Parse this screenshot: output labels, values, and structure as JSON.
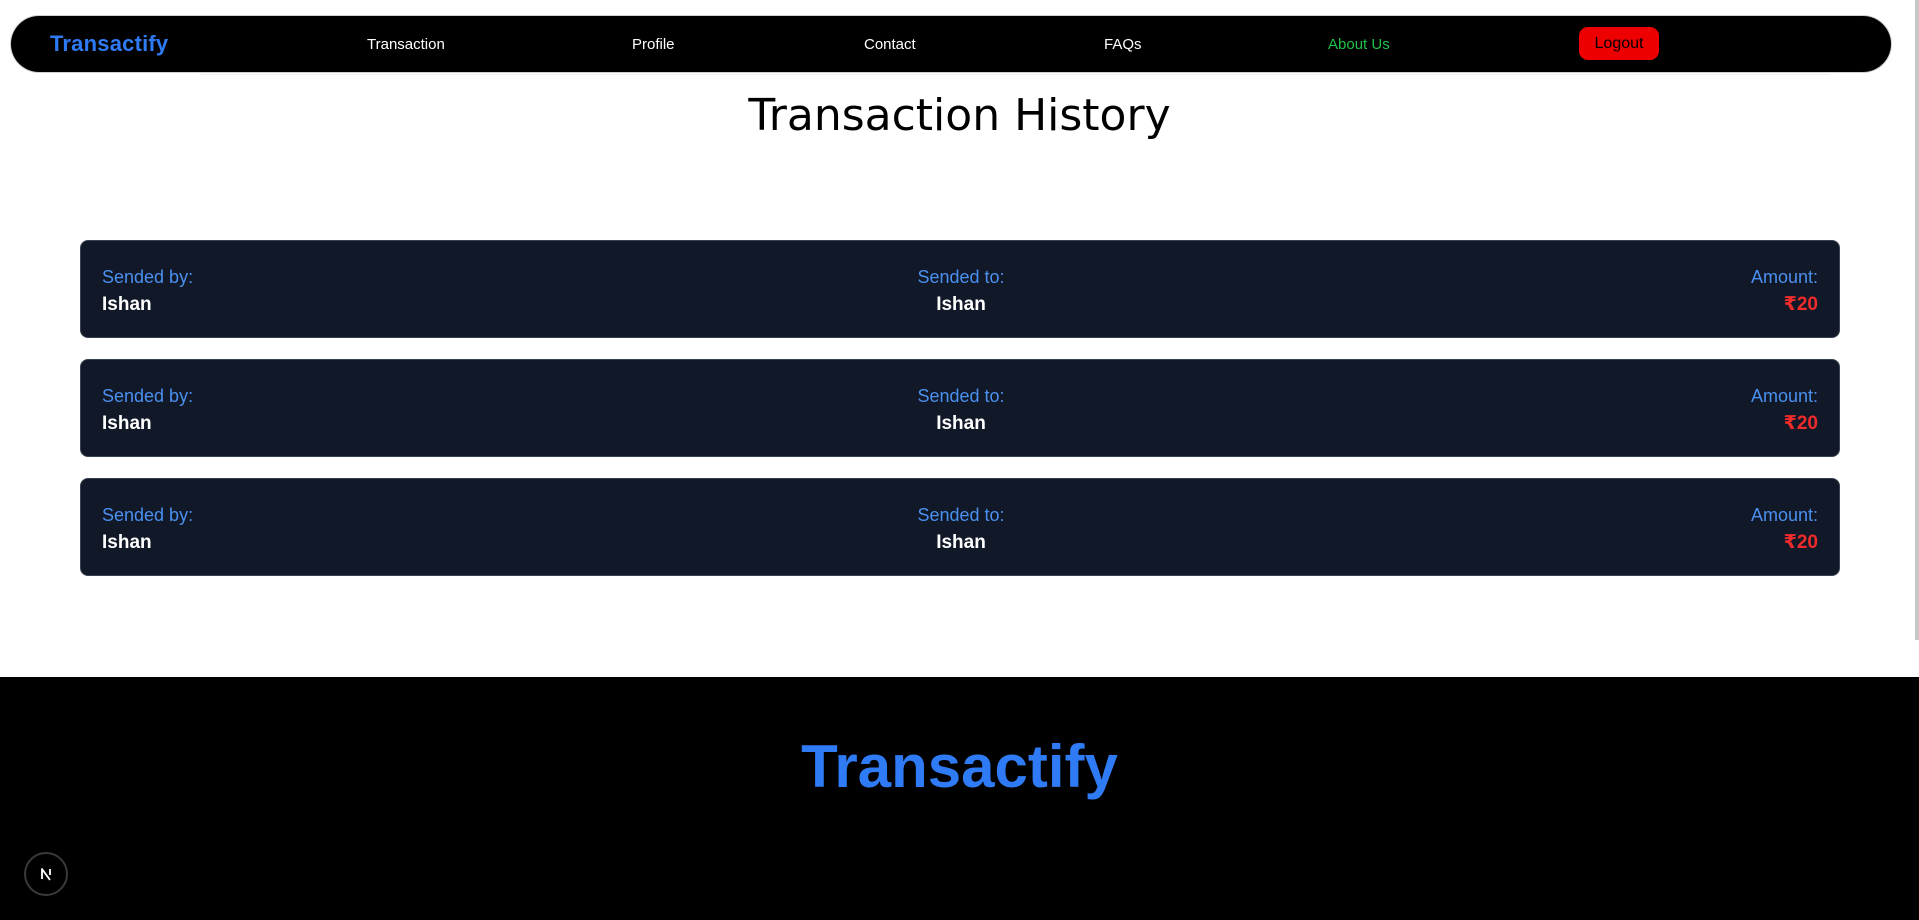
{
  "navbar": {
    "brand": "Transactify",
    "links": [
      {
        "label": "Transaction"
      },
      {
        "label": "Profile"
      },
      {
        "label": "Contact"
      },
      {
        "label": "FAQs"
      },
      {
        "label": "About Us"
      }
    ],
    "logout_label": "Logout",
    "active_link_color": "#1fc24b",
    "logout_color": "#ef0000"
  },
  "main": {
    "title": "Transaction History",
    "transactions": [
      {
        "sender_label": "Sended by:",
        "sender": "Ishan",
        "recipient_label": "Sended to:",
        "recipient": "Ishan",
        "amount_label": "Amount:",
        "amount": "₹20"
      },
      {
        "sender_label": "Sended by:",
        "sender": "Ishan",
        "recipient_label": "Sended to:",
        "recipient": "Ishan",
        "amount_label": "Amount:",
        "amount": "₹20"
      },
      {
        "sender_label": "Sended by:",
        "sender": "Ishan",
        "recipient_label": "Sended to:",
        "recipient": "Ishan",
        "amount_label": "Amount:",
        "amount": "₹20"
      }
    ]
  },
  "footer": {
    "brand": "Transactify"
  },
  "dev_badge": {
    "icon": "nextjs-logo-icon",
    "glyph": "N"
  },
  "colors": {
    "brand": "#2f7bf5",
    "card_bg": "#111827",
    "label": "#4a90f0",
    "amount": "#ef2b2b"
  }
}
